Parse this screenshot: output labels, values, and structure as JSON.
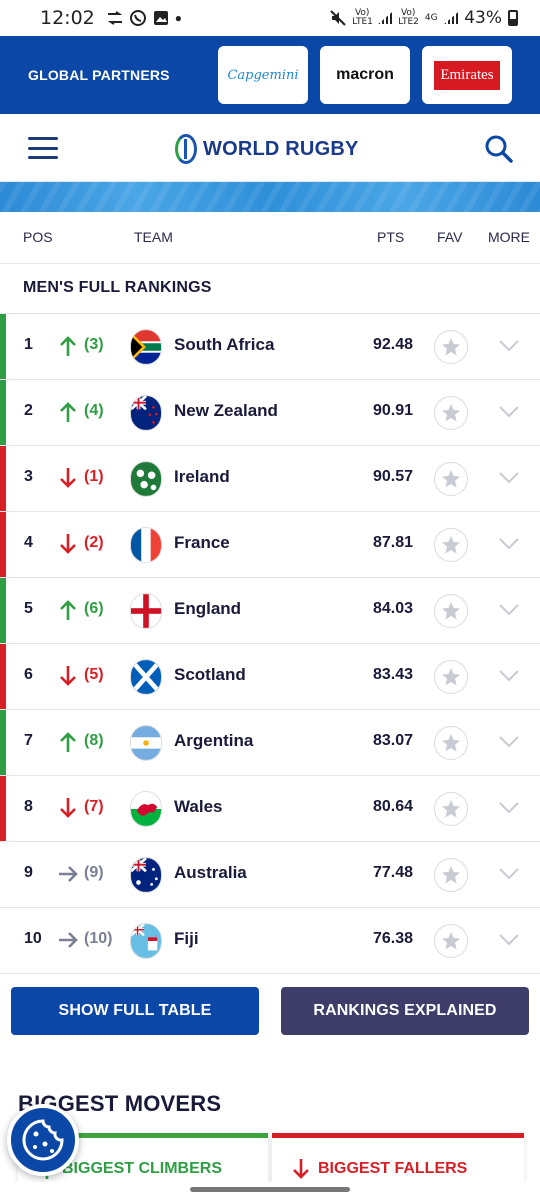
{
  "status_bar": {
    "time": "12:02",
    "left_icons": [
      "sync-icon",
      "whatsapp-icon",
      "gallery-icon",
      "dot-icon"
    ],
    "sim1_label": "Vo) LTE1",
    "sim2_label": "Vo) LTE2",
    "network": "4G",
    "battery": "43%"
  },
  "partners": {
    "title": "GLOBAL PARTNERS",
    "logos": [
      "Capgemini",
      "macron",
      "Emirates"
    ]
  },
  "header": {
    "brand": "WORLD RUGBY"
  },
  "columns": {
    "pos": "POS",
    "team": "TEAM",
    "pts": "PTS",
    "fav": "FAV",
    "more": "MORE"
  },
  "section_title": "MEN'S FULL RANKINGS",
  "rankings": [
    {
      "pos": "1",
      "prev": "(3)",
      "trend": "up",
      "team": "South Africa",
      "pts": "92.48"
    },
    {
      "pos": "2",
      "prev": "(4)",
      "trend": "up",
      "team": "New Zealand",
      "pts": "90.91"
    },
    {
      "pos": "3",
      "prev": "(1)",
      "trend": "down",
      "team": "Ireland",
      "pts": "90.57"
    },
    {
      "pos": "4",
      "prev": "(2)",
      "trend": "down",
      "team": "France",
      "pts": "87.81"
    },
    {
      "pos": "5",
      "prev": "(6)",
      "trend": "up",
      "team": "England",
      "pts": "84.03"
    },
    {
      "pos": "6",
      "prev": "(5)",
      "trend": "down",
      "team": "Scotland",
      "pts": "83.43"
    },
    {
      "pos": "7",
      "prev": "(8)",
      "trend": "up",
      "team": "Argentina",
      "pts": "83.07"
    },
    {
      "pos": "8",
      "prev": "(7)",
      "trend": "down",
      "team": "Wales",
      "pts": "80.64"
    },
    {
      "pos": "9",
      "prev": "(9)",
      "trend": "same",
      "team": "Australia",
      "pts": "77.48"
    },
    {
      "pos": "10",
      "prev": "(10)",
      "trend": "same",
      "team": "Fiji",
      "pts": "76.38"
    }
  ],
  "buttons": {
    "show_full_table": "SHOW FULL TABLE",
    "rankings_explained": "RANKINGS EXPLAINED"
  },
  "movers": {
    "title": "BIGGEST MOVERS",
    "climbers": "BIGGEST CLIMBERS",
    "fallers": "BIGGEST FALLERS"
  },
  "colors": {
    "up": "#2f9e44",
    "down": "#d71f26",
    "same": "#7a7f95",
    "primary": "#0a47a6",
    "secondary": "#3e3d6a"
  }
}
